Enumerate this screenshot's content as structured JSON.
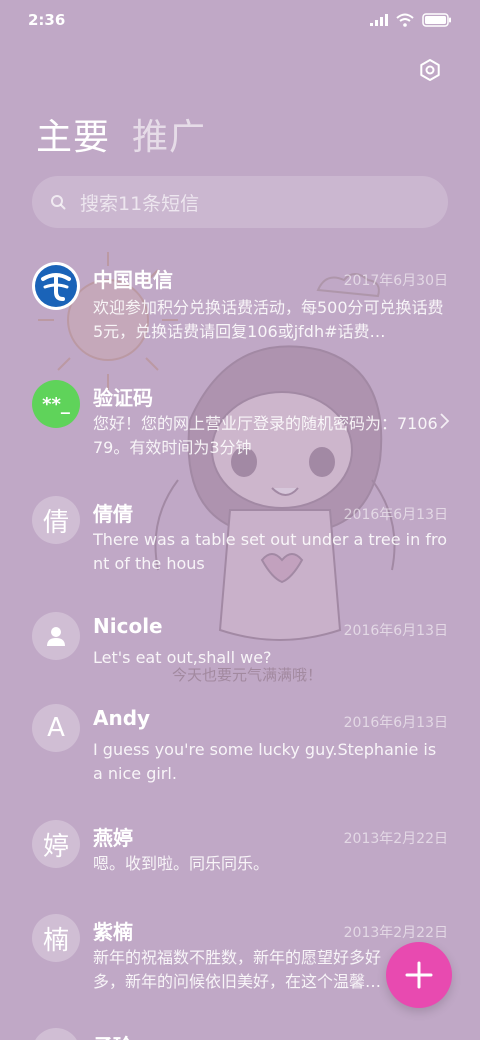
{
  "status": {
    "time": "2:36"
  },
  "tabs": {
    "primary": "主要",
    "secondary": "推广"
  },
  "search": {
    "placeholder": "搜索11条短信"
  },
  "messages": [
    {
      "name": "中国电信",
      "date": "2017年6月30日",
      "preview": "欢迎参加积分兑换话费活动，每500分可兑换话费5元，兑换话费请回复106或jfdh#话费…",
      "avatar": "china-telecom-logo"
    },
    {
      "name": "验证码",
      "date": "",
      "preview": "您好！您的网上营业厅登录的随机密码为：710679。有效时间为3分钟",
      "avatar_text": "**_"
    },
    {
      "name": "倩倩",
      "date": "2016年6月13日",
      "preview": "There was a table set out under a tree in front of the hous",
      "avatar_text": "倩"
    },
    {
      "name": "Nicole",
      "date": "2016年6月13日",
      "preview": "Let's eat out,shall we?",
      "avatar": "person-icon"
    },
    {
      "name": "Andy",
      "date": "2016年6月13日",
      "preview": "I guess you're some lucky guy.Stephanie is a nice girl.",
      "avatar_text": "A"
    },
    {
      "name": "燕婷",
      "date": "2013年2月22日",
      "preview": "嗯。收到啦。同乐同乐。",
      "avatar_text": "婷"
    },
    {
      "name": "紫楠",
      "date": "2013年2月22日",
      "preview": "新年的祝福数不胜数，新年的愿望好多好多，新年的问候依旧美好，在这个温馨的时刻…",
      "avatar_text": "楠"
    },
    {
      "name": "子玲",
      "avatar_text": "玲"
    }
  ],
  "wallpaper": {
    "caption": "今天也要元气满满哦！"
  },
  "colors": {
    "background": "#c0a8c6",
    "fab": "#e84ab0",
    "verify_avatar": "#5fd35a",
    "telecom_blue": "#1a63b8"
  }
}
